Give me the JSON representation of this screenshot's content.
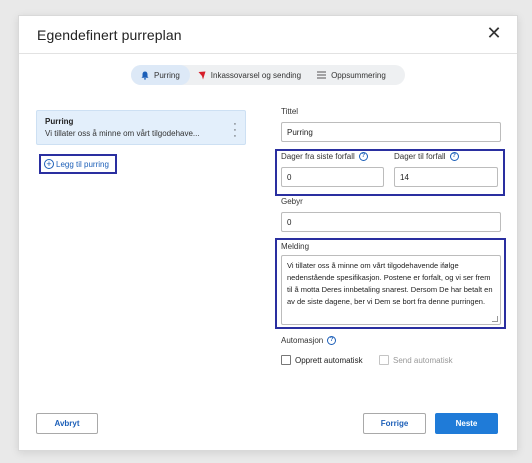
{
  "dialog": {
    "title": "Egendefinert purreplan",
    "close_icon": "close-icon"
  },
  "steps": [
    {
      "label": "Purring",
      "icon": "bell-icon",
      "active": true
    },
    {
      "label": "Inkassovarsel og sending",
      "icon": "flag-icon",
      "active": false
    },
    {
      "label": "Oppsummering",
      "icon": "list-icon",
      "active": false
    }
  ],
  "reminders": {
    "items": [
      {
        "name": "Purring",
        "description": "Vi tillater oss å minne om vårt tilgodehave...",
        "menu_icon": "kebab-menu-icon"
      }
    ],
    "add_label": "Legg til purring"
  },
  "form": {
    "title_label": "Tittel",
    "title_value": "Purring",
    "days_since_label": "Dager fra siste forfall",
    "days_since_value": "0",
    "days_due_label": "Dager til forfall",
    "days_due_value": "14",
    "fee_label": "Gebyr",
    "fee_value": "0",
    "message_label": "Melding",
    "message_value": "Vi tillater oss å minne om vårt tilgodehavende ifølge nedenstående spesifikasjon. Postene er forfalt, og vi ser frem til å motta Deres innbetaling snarest. Dersom De har betalt en av de siste dagene, ber vi Dem se bort fra denne purringen.",
    "automation_label": "Automasjon",
    "auto_create_label": "Opprett automatisk",
    "auto_send_label": "Send automatisk",
    "help_icon": "help-icon"
  },
  "footer": {
    "cancel_label": "Avbryt",
    "prev_label": "Forrige",
    "next_label": "Neste"
  },
  "colors": {
    "primary": "#1f7bd8",
    "highlight": "#2a2fa0",
    "active_step": "#dde9f7",
    "selected_item": "#e3effb"
  }
}
